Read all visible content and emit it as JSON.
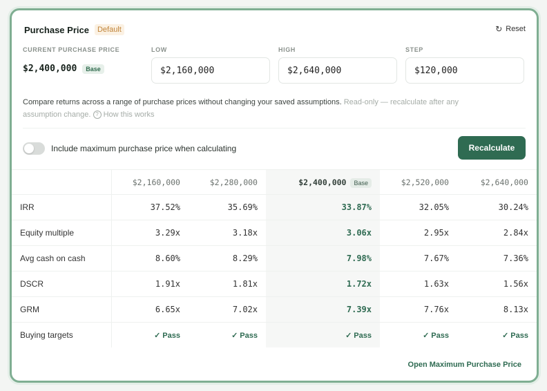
{
  "header": {
    "title": "Purchase Price",
    "default_tag": "Default",
    "reset_label": "Reset",
    "reset_icon": "↻"
  },
  "inputs": {
    "current_label": "CURRENT PURCHASE PRICE",
    "current_value": "$2,400,000",
    "current_badge": "Base",
    "low_label": "LOW",
    "low_value": "$2,160,000",
    "high_label": "HIGH",
    "high_value": "$2,640,000",
    "step_label": "STEP",
    "step_value": "$120,000"
  },
  "description": {
    "main": "Compare returns across a range of purchase prices without changing your saved assumptions.",
    "muted": "Read-only — recalculate after any assumption change.",
    "help_icon": "?",
    "help_link": "How this works"
  },
  "options": {
    "toggle_label": "Include maximum purchase price when calculating",
    "toggle_on": false,
    "recalculate_label": "Recalculate"
  },
  "table": {
    "columns": [
      "$2,160,000",
      "$2,280,000",
      "$2,400,000",
      "$2,520,000",
      "$2,640,000"
    ],
    "base_badge": "Base",
    "rows": [
      {
        "metric": "IRR",
        "values": [
          "37.52%",
          "35.69%",
          "33.87%",
          "32.05%",
          "30.24%"
        ]
      },
      {
        "metric": "Equity multiple",
        "values": [
          "3.29x",
          "3.18x",
          "3.06x",
          "2.95x",
          "2.84x"
        ]
      },
      {
        "metric": "Avg cash on cash",
        "values": [
          "8.60%",
          "8.29%",
          "7.98%",
          "7.67%",
          "7.36%"
        ]
      },
      {
        "metric": "DSCR",
        "values": [
          "1.91x",
          "1.81x",
          "1.72x",
          "1.63x",
          "1.56x"
        ]
      },
      {
        "metric": "GRM",
        "values": [
          "6.65x",
          "7.02x",
          "7.39x",
          "7.76x",
          "8.13x"
        ]
      },
      {
        "metric": "Buying targets",
        "values": [
          "Pass",
          "Pass",
          "Pass",
          "Pass",
          "Pass"
        ]
      }
    ],
    "pass_icon": "✓"
  },
  "footer": {
    "link_label": "Open Maximum Purchase Price"
  },
  "colors": {
    "accent": "#2f6b52",
    "border": "#7fae92",
    "default_tag": "#c0843a"
  }
}
